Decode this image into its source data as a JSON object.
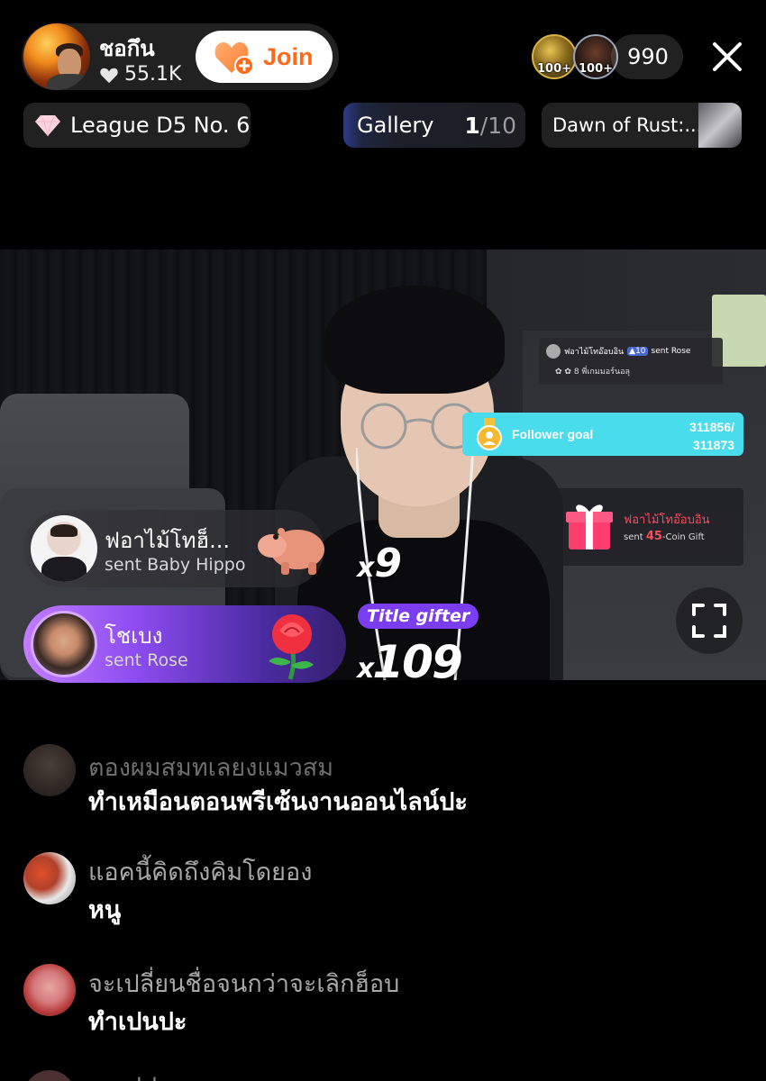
{
  "host": {
    "name": "ชอกึน",
    "likes": "55.1K",
    "join_label": "Join"
  },
  "viewers": {
    "badges": [
      "100+",
      "100+"
    ],
    "count": "990"
  },
  "info_bar": {
    "league": "League D5 No. 6",
    "gallery_label": "Gallery",
    "gallery_current": "1",
    "gallery_total": "/10",
    "event_title": "Dawn of Rust:..."
  },
  "stream_overlays": {
    "gift_alert": {
      "sender": "ฟอาไม้โทอ๊อบอิน",
      "level": "10",
      "action": "sent Rose",
      "detail": "พี่เกมมอร์นอลุ",
      "count": "8"
    },
    "follower_goal": {
      "label": "Follower goal",
      "current": "311856/",
      "target": "311873"
    },
    "coin_gift": {
      "sender": "ฟอาไม้โทอ๊อบอิน",
      "sent_prefix": "sent",
      "amount": "45",
      "suffix": "-Coin Gift"
    }
  },
  "gift_notifications": [
    {
      "sender": "ฟอาไม้โทฮ็...",
      "message": "sent Baby Hippo",
      "gift_icon": "hippo-icon",
      "combo_prefix": "x",
      "combo": "9"
    },
    {
      "sender": "โชเบง",
      "message": "sent Rose",
      "gift_icon": "rose-icon",
      "combo_prefix": "x",
      "combo": "109",
      "tag": "Title gifter"
    }
  ],
  "comments": [
    {
      "user": "ตองผมสมทเลยงแมวสม",
      "text": "ทำเหมือนตอนพรีเซ้นงานออนไลน์ปะ"
    },
    {
      "user": "แอคนี้คิดถึงคิมโดยอง",
      "text": "หนู"
    },
    {
      "user": "จะเปลี่ยนชื่อจนกว่าจะเลิกฮ็อบ",
      "text": "ทำเปนปะ"
    },
    {
      "user": "• แปป •",
      "text": ""
    }
  ],
  "colors": {
    "join_text": "#ff6a1a",
    "follower_goal_bg": "#49dcec",
    "title_gifter_bg": "#7a3df0",
    "coin_gift_accent": "#ff4a5a"
  }
}
